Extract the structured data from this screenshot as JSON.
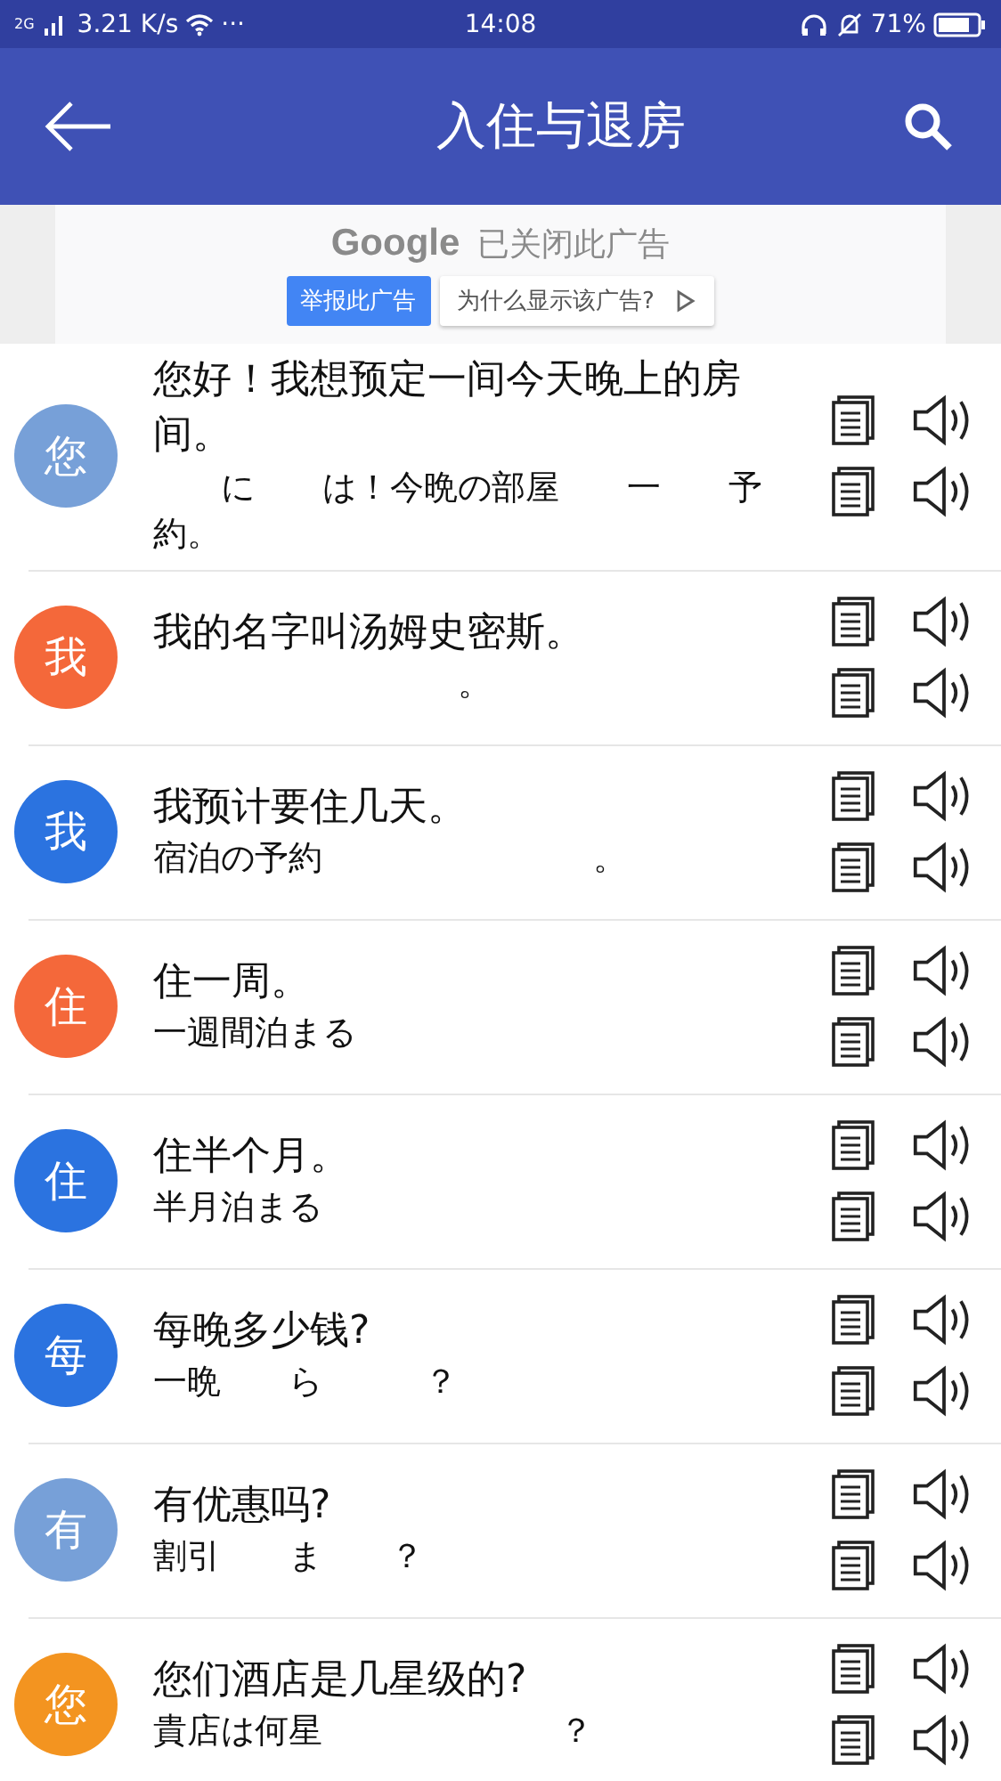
{
  "status_bar": {
    "network": "2G",
    "speed": "3.21 K/s",
    "more": "···",
    "time": "14:08",
    "battery": "71%"
  },
  "header": {
    "title": "入住与退房"
  },
  "ad": {
    "headline_brand": "Google",
    "headline": "已关闭此广告",
    "report_button": "举报此广告",
    "why_button": "为什么显示该广告?"
  },
  "phrases": [
    {
      "avatar": "您",
      "color": "#77a0d8",
      "chinese": "您好！我想预定一间今天晚上的房间。",
      "japanese": "　　に　　は！今晩の部屋　　一　　予約。"
    },
    {
      "avatar": "我",
      "color": "#f4683a",
      "chinese": "我的名字叫汤姆史密斯。",
      "japanese": "　　　　　　　　　。"
    },
    {
      "avatar": "我",
      "color": "#2b73e0",
      "chinese": "我预计要住几天。",
      "japanese": "宿泊の予約　　　　　　　　。"
    },
    {
      "avatar": "住",
      "color": "#f4683a",
      "chinese": "住一周。",
      "japanese": "一週間泊まる"
    },
    {
      "avatar": "住",
      "color": "#2b73e0",
      "chinese": "住半个月。",
      "japanese": "半月泊まる"
    },
    {
      "avatar": "每",
      "color": "#2b73e0",
      "chinese": "每晚多少钱?",
      "japanese": "一晩　　ら　　　？"
    },
    {
      "avatar": "有",
      "color": "#77a0d8",
      "chinese": "有优惠吗?",
      "japanese": "割引　　ま　　？"
    },
    {
      "avatar": "您",
      "color": "#f39420",
      "chinese": "您们酒店是几星级的?",
      "japanese": "貴店は何星　　　　　　　？"
    }
  ]
}
